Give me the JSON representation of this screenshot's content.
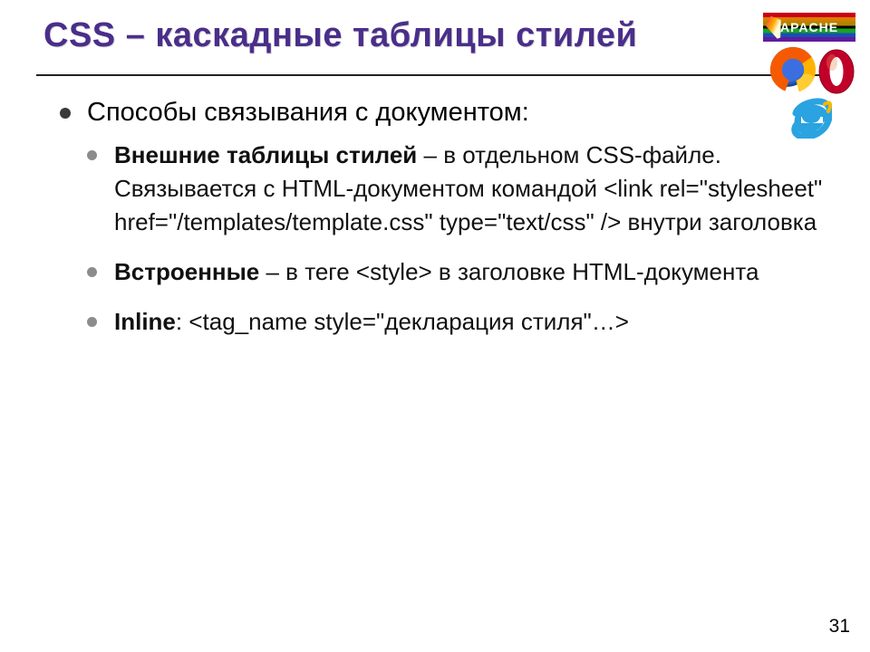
{
  "title": "CSS – каскадные таблицы стилей",
  "logos": {
    "apache_text": "APACHE"
  },
  "main": {
    "intro": "Способы связывания с документом:",
    "items": [
      {
        "bold": "Внешние таблицы стилей",
        "rest": " – в отдельном CSS-файле. Связывается с HTML-документом командой <link rel=\"stylesheet\" href=\"/templates/template.css\" type=\"text/css\" /> внутри заголовка"
      },
      {
        "bold": "Встроенные",
        "rest": " – в теге <style> в заголовке HTML-документа"
      },
      {
        "bold": "Inline",
        "rest": ": <tag_name style=\"декларация стиля\"…>"
      }
    ]
  },
  "page_number": "31"
}
